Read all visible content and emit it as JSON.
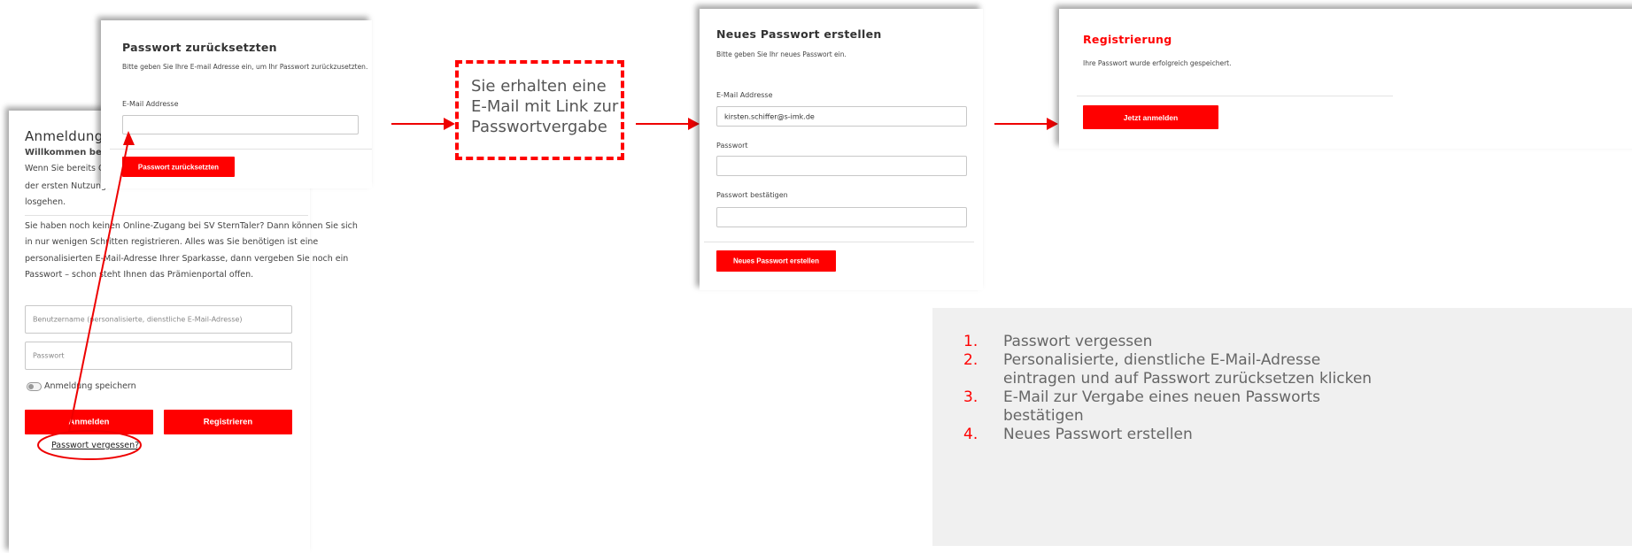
{
  "login": {
    "title": "Anmeldung",
    "welcome": "Willkommen beim O",
    "p1_line1": "Wenn Sie bereits Onli",
    "p1_line2": "der ersten Nutzung di",
    "p1_line3": "losgehen.",
    "p2_line1": "Sie haben noch keinen Online-Zugang bei SV SternTaler? Dann können Sie sich",
    "p2_line2": "in nur wenigen Schritten registrieren. Alles was Sie benötigen ist eine",
    "p2_line3": "personalisierten E-Mail-Adresse Ihrer Sparkasse, dann vergeben Sie noch ein",
    "p2_line4": "Passwort – schon steht Ihnen das Prämienportal offen.",
    "username_placeholder": "Benutzername (personalisierte, dienstliche E-Mail-Adresse)",
    "password_placeholder": "Passwort",
    "remember_label": "Anmeldung speichern",
    "login_button": "Anmelden",
    "register_button": "Registrieren",
    "forgot_link": "Passwort vergessen?"
  },
  "reset": {
    "title": "Passwort zurücksetzten",
    "subtitle": "Bitte geben Sie Ihre E-mail Adresse ein, um Ihr Passwort zurückzusetzten.",
    "email_label": "E-Mail Addresse",
    "email_value": "",
    "button": "Passwort zurücksetzten"
  },
  "note": {
    "line1": "Sie erhalten eine",
    "line2": "E-Mail mit Link zur",
    "line3": "Passwortvergabe"
  },
  "newpw": {
    "title": "Neues Passwort erstellen",
    "subtitle": "Bitte geben Sie Ihr neues Passwort ein.",
    "email_label": "E-Mail Addresse",
    "email_value": "kirsten.schiffer@s-imk.de",
    "password_label": "Passwort",
    "password_value": "",
    "confirm_label": "Passwort bestätigen",
    "confirm_value": "",
    "button": "Neues Passwort erstellen"
  },
  "registration": {
    "title": "Registrierung",
    "message": "Ihre Passwort wurde erfolgreich gespeichert.",
    "button": "Jetzt anmelden"
  },
  "steps": [
    {
      "num": "1.",
      "line1": "Passwort vergessen",
      "line2": ""
    },
    {
      "num": "2.",
      "line1": "Personalisierte, dienstliche E-Mail-Adresse",
      "line2": "eintragen und auf Passwort zurücksetzen klicken"
    },
    {
      "num": "3.",
      "line1": "E-Mail zur Vergabe eines neuen Passworts",
      "line2": "bestätigen"
    },
    {
      "num": "4.",
      "line1": "Neues Passwort erstellen",
      "line2": ""
    }
  ],
  "colors": {
    "accent": "#ff0000",
    "step_bg": "#f0f0f0"
  }
}
